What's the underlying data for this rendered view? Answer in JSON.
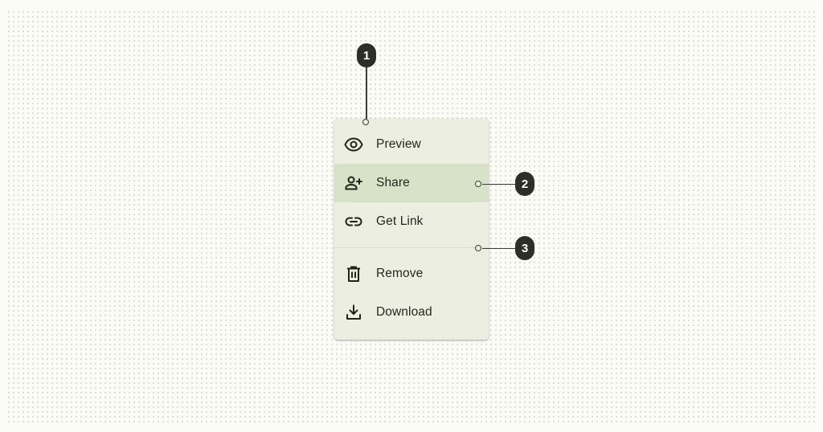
{
  "menu": {
    "items": [
      {
        "label": "Preview",
        "icon": "eye-icon"
      },
      {
        "label": "Share",
        "icon": "person-add-icon"
      },
      {
        "label": "Get Link",
        "icon": "link-icon"
      },
      {
        "label": "Remove",
        "icon": "trash-icon"
      },
      {
        "label": "Download",
        "icon": "download-icon"
      }
    ]
  },
  "annotations": {
    "a1": "1",
    "a2": "2",
    "a3": "3"
  },
  "colors": {
    "background": "#fcfcf6",
    "menu_surface": "#ebeee1",
    "hover_highlight": "#d7e2c9",
    "badge": "#2c2f28"
  }
}
